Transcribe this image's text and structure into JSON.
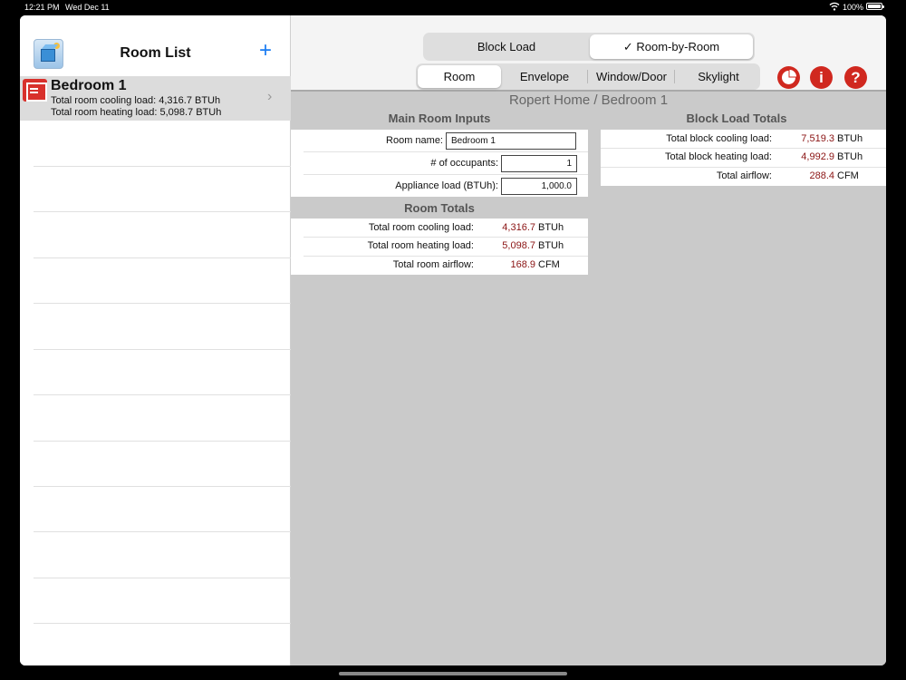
{
  "status_bar": {
    "time": "12:21 PM",
    "date": "Wed Dec 11",
    "battery": "100%"
  },
  "sidebar": {
    "title": "Room List",
    "add_icon": "plus-icon",
    "items": [
      {
        "name": "Bedroom 1",
        "cooling_line": "Total room cooling load: 4,316.7 BTUh",
        "heating_line": "Total room heating load: 5,098.7 BTUh"
      }
    ]
  },
  "toolbar": {
    "mode_tabs": [
      {
        "label": "Block Load",
        "selected": false
      },
      {
        "label": "✓ Room-by-Room",
        "selected": true
      }
    ],
    "section_tabs": [
      {
        "label": "Room",
        "selected": true
      },
      {
        "label": "Envelope",
        "selected": false
      },
      {
        "label": "Window/Door",
        "selected": false
      },
      {
        "label": "Skylight",
        "selected": false
      }
    ],
    "icons": [
      "pie-chart-icon",
      "info-icon",
      "help-icon"
    ],
    "info_glyph": "i",
    "help_glyph": "?"
  },
  "breadcrumb": "Ropert Home / Bedroom 1",
  "main_room_inputs": {
    "heading": "Main Room Inputs",
    "room_name_label": "Room name:",
    "room_name_value": "Bedroom 1",
    "occupants_label": "# of occupants:",
    "occupants_value": "1",
    "appliance_label": "Appliance load (BTUh):",
    "appliance_value": "1,000.0"
  },
  "room_totals": {
    "heading": "Room Totals",
    "rows": [
      {
        "label": "Total room cooling load:",
        "value": "4,316.7",
        "unit": "BTUh"
      },
      {
        "label": "Total room heating load:",
        "value": "5,098.7",
        "unit": "BTUh"
      },
      {
        "label": "Total room airflow:",
        "value": "168.9",
        "unit": "CFM"
      }
    ]
  },
  "block_load_totals": {
    "heading": "Block Load Totals",
    "rows": [
      {
        "label": "Total block cooling load:",
        "value": "7,519.3",
        "unit": "BTUh"
      },
      {
        "label": "Total block heating load:",
        "value": "4,992.9",
        "unit": "BTUh"
      },
      {
        "label": "Total airflow:",
        "value": "288.4",
        "unit": "CFM"
      }
    ]
  },
  "colors": {
    "accent_blue": "#1a7cf2",
    "value_red": "#8b1414",
    "icon_red": "#d0281f"
  }
}
